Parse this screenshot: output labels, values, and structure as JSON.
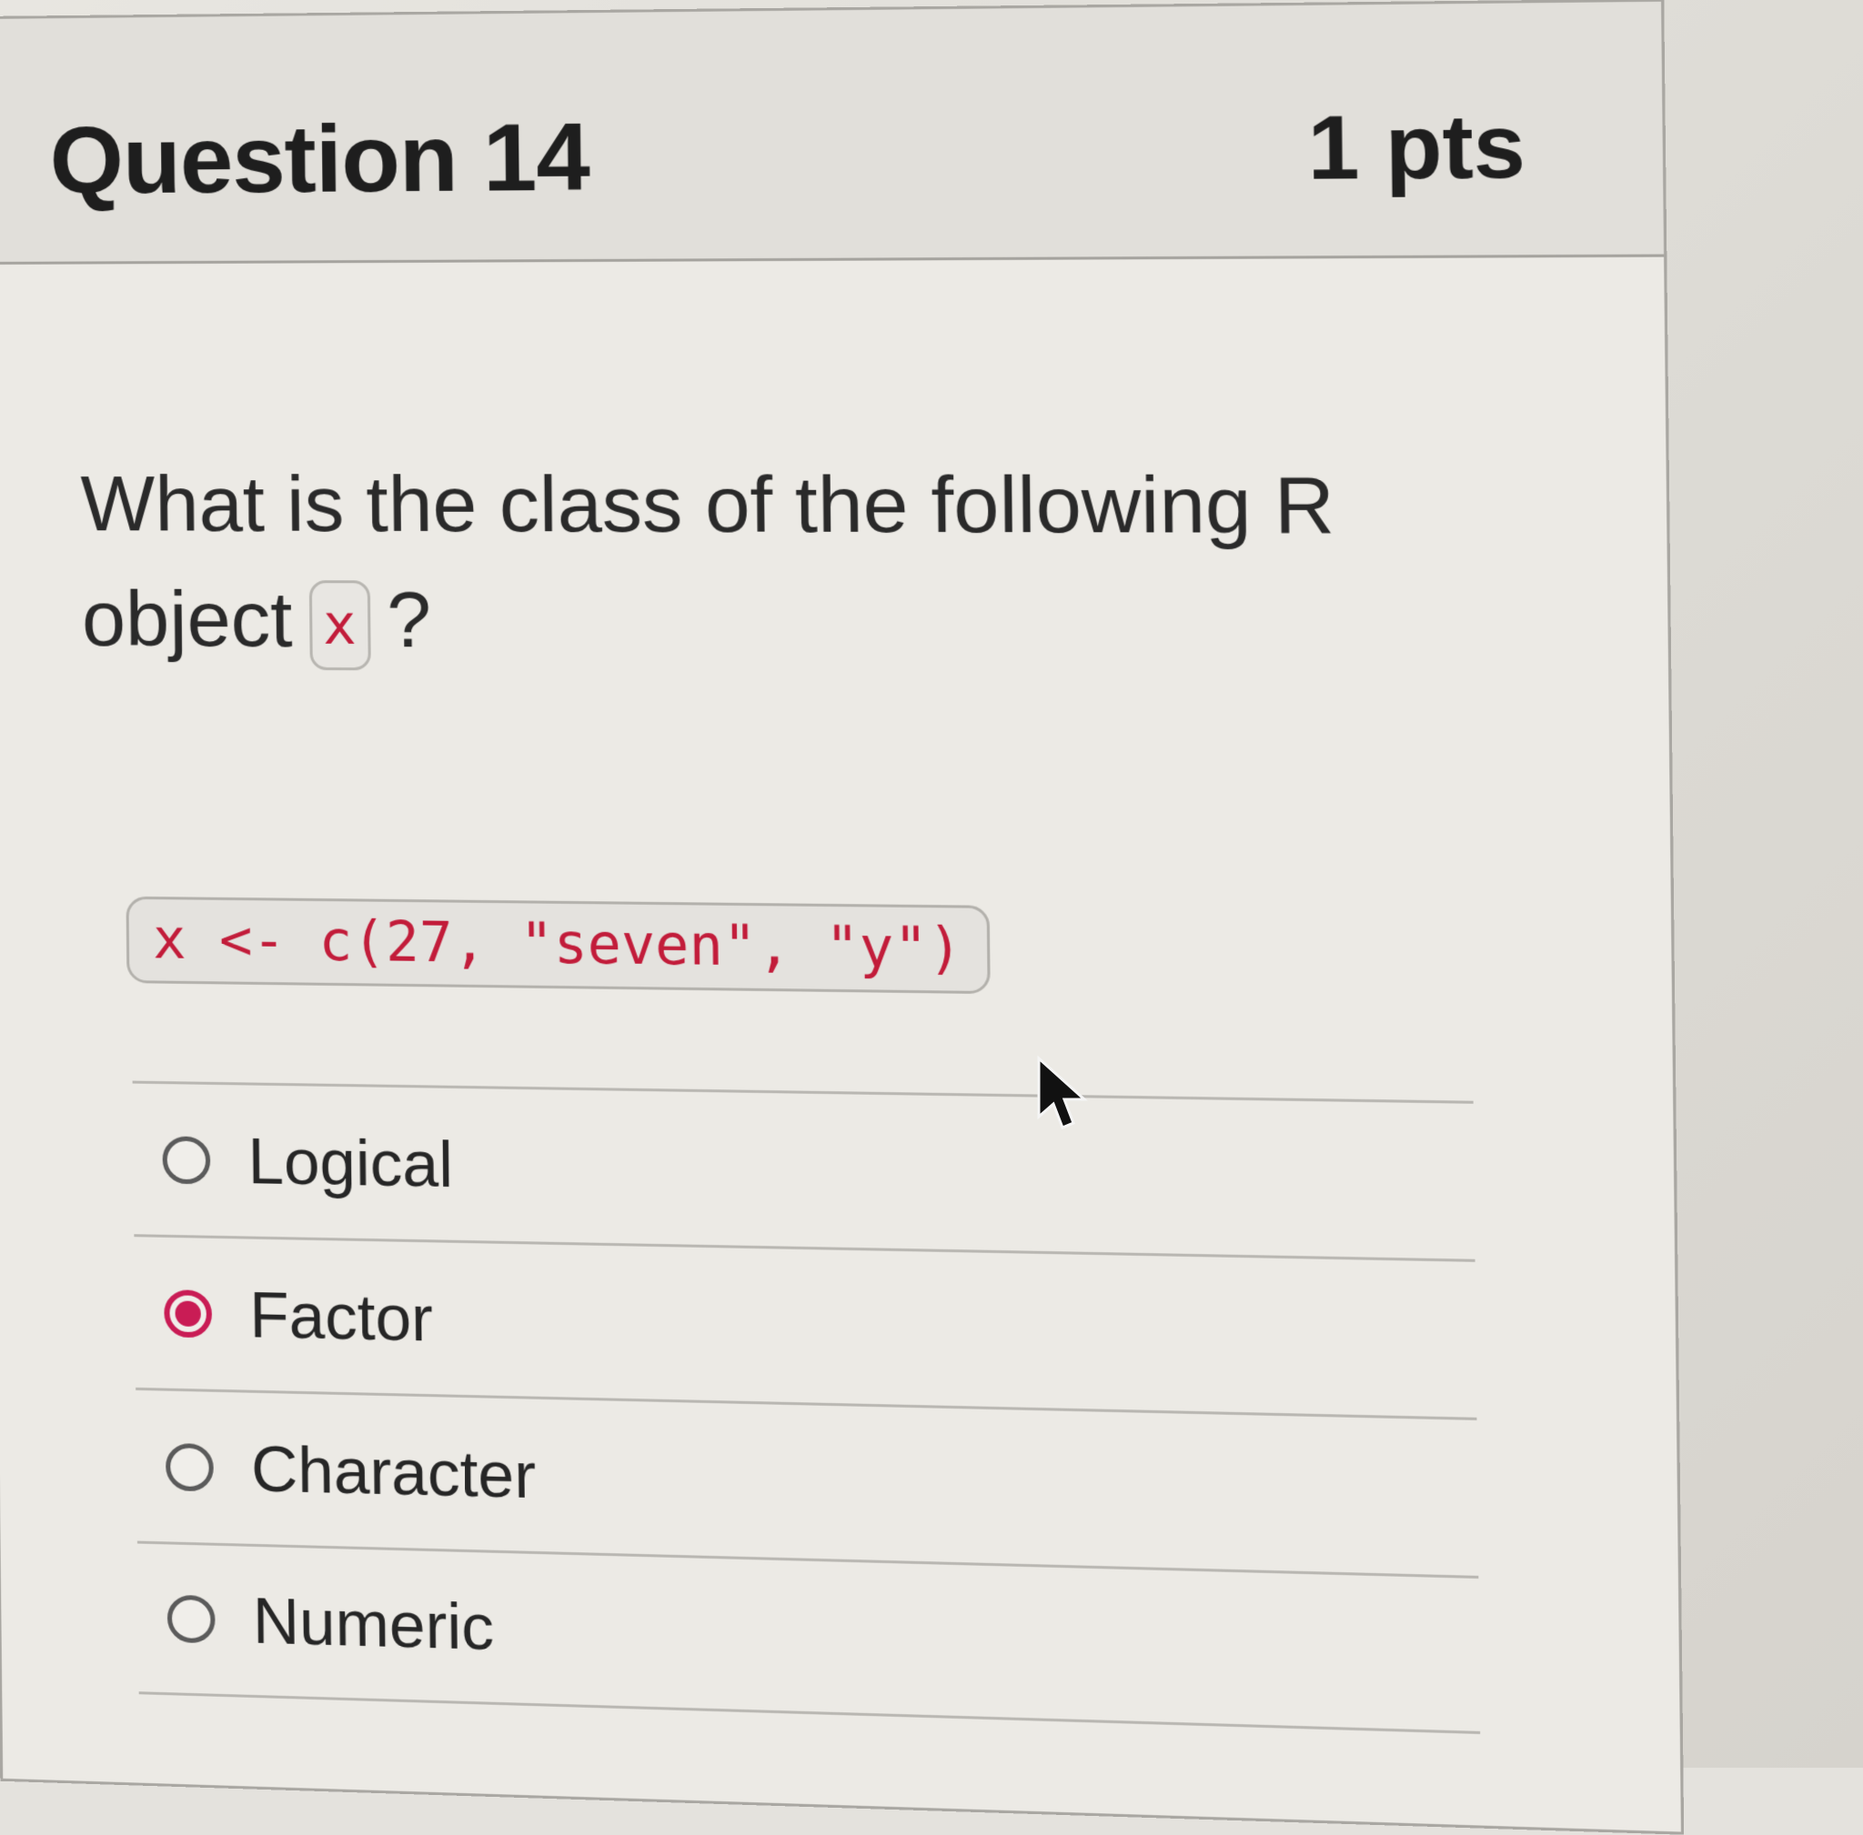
{
  "question": {
    "title": "Question 14",
    "points": "1 pts",
    "text_before": "What is the class of the following R object",
    "inline_code": "x",
    "text_after": "?",
    "code": "x <- c(27, \"seven\", \"y\")"
  },
  "answers": [
    {
      "label": "Logical",
      "selected": false
    },
    {
      "label": "Factor",
      "selected": true
    },
    {
      "label": "Character",
      "selected": false
    },
    {
      "label": "Numeric",
      "selected": false
    }
  ],
  "colors": {
    "code_text": "#c21c3a",
    "selected_radio": "#c91c55"
  },
  "icons": {
    "cursor": "mouse-pointer-icon"
  }
}
